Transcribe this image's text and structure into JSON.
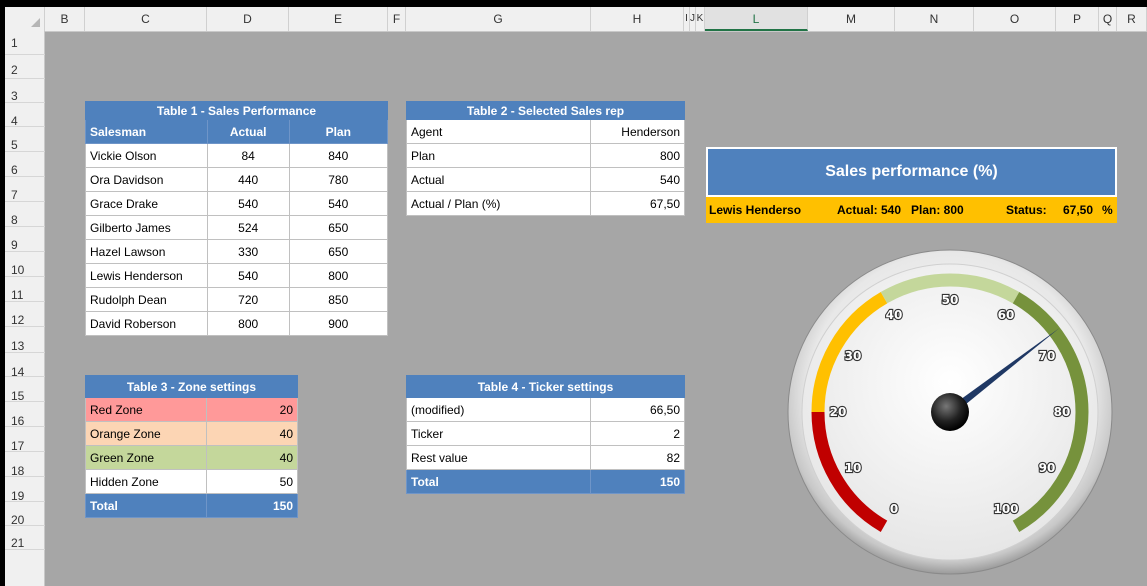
{
  "columns": [
    "B",
    "C",
    "D",
    "E",
    "F",
    "G",
    "H",
    "I",
    "J",
    "K",
    "L",
    "M",
    "N",
    "O",
    "P",
    "Q",
    "R"
  ],
  "selected_column": "L",
  "rows": [
    "1",
    "2",
    "3",
    "4",
    "5",
    "6",
    "7",
    "8",
    "9",
    "10",
    "11",
    "12",
    "13",
    "14",
    "15",
    "16",
    "17",
    "18",
    "19",
    "20",
    "21"
  ],
  "table1": {
    "title": "Table 1 - Sales Performance",
    "headers": [
      "Salesman",
      "Actual",
      "Plan"
    ],
    "rows": [
      [
        "Vickie Olson",
        "84",
        "840"
      ],
      [
        "Ora Davidson",
        "440",
        "780"
      ],
      [
        "Grace Drake",
        "540",
        "540"
      ],
      [
        "Gilberto James",
        "524",
        "650"
      ],
      [
        "Hazel Lawson",
        "330",
        "650"
      ],
      [
        "Lewis Henderson",
        "540",
        "800"
      ],
      [
        "Rudolph Dean",
        "720",
        "850"
      ],
      [
        "David Roberson",
        "800",
        "900"
      ]
    ]
  },
  "table2": {
    "title": "Table 2 - Selected Sales rep",
    "rows": [
      [
        "Agent",
        "Henderson"
      ],
      [
        "Plan",
        "800"
      ],
      [
        "Actual",
        "540"
      ],
      [
        "Actual / Plan (%)",
        "67,50"
      ]
    ]
  },
  "table3": {
    "title": "Table 3 - Zone settings",
    "rows": [
      [
        "Red Zone",
        "20"
      ],
      [
        "Orange Zone",
        "40"
      ],
      [
        "Green Zone",
        "40"
      ],
      [
        "Hidden Zone",
        "50"
      ]
    ],
    "total_label": "Total",
    "total_value": "150"
  },
  "table4": {
    "title": "Table 4 - Ticker settings",
    "rows": [
      [
        "(modified)",
        "66,50"
      ],
      [
        "Ticker",
        "2"
      ],
      [
        "Rest value",
        "82"
      ]
    ],
    "total_label": "Total",
    "total_value": "150"
  },
  "banner": {
    "title": "Sales performance (%)",
    "name": "Lewis Henderso",
    "actual": "Actual: 540",
    "plan": "Plan: 800",
    "status_label": "Status:",
    "status_value": "67,50",
    "status_unit": "%"
  },
  "gauge": {
    "ticks": [
      "0",
      "10",
      "20",
      "30",
      "40",
      "50",
      "60",
      "70",
      "80",
      "90",
      "100"
    ],
    "needle_value": 67.5,
    "colors": {
      "red": "#c00000",
      "orange": "#ffc000",
      "green_light": "#c4d79b",
      "green_dark": "#76923c",
      "needle": "#1f3864"
    }
  },
  "colors": {
    "header_blue": "#4f81bd",
    "banner_yellow": "#ffc000",
    "sheet_bg": "#a6a6a6"
  }
}
